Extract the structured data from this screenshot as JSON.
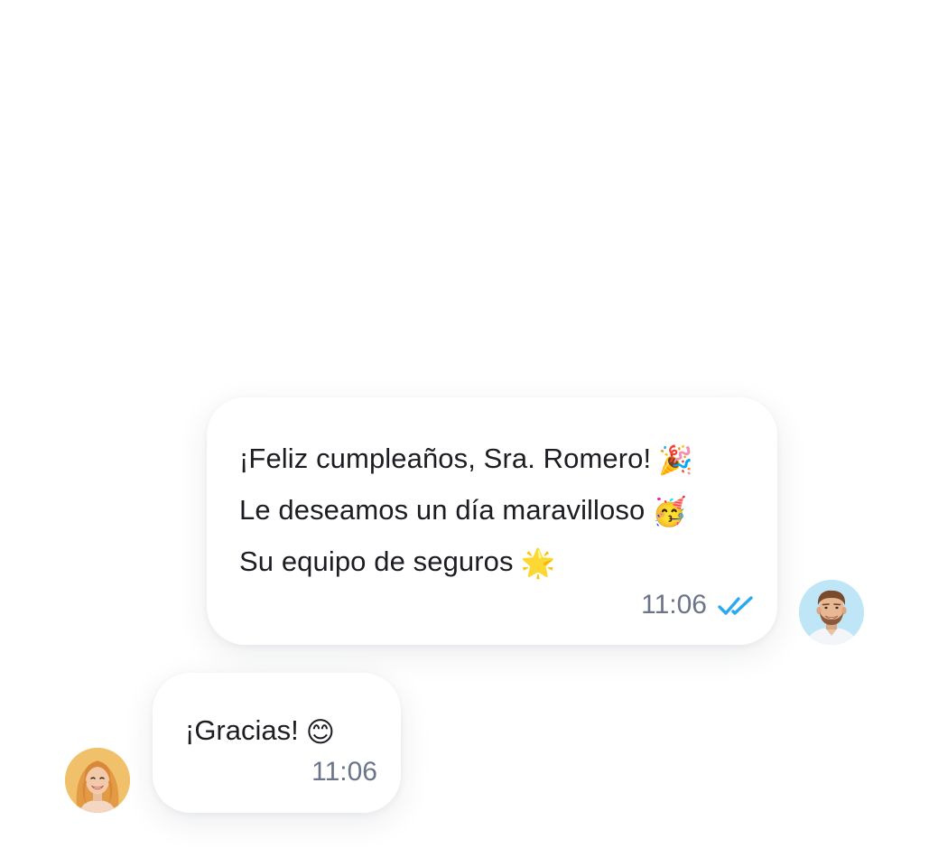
{
  "conversation": {
    "outgoing_message": {
      "lines": [
        {
          "text": "¡Feliz cumpleaños, Sra. Romero!",
          "emoji": "🎉"
        },
        {
          "text": "Le deseamos un día maravilloso",
          "emoji": "🥳"
        },
        {
          "text": "Su equipo de seguros",
          "emoji": "🌟"
        }
      ],
      "time": "11:06",
      "status_icon": "double-check-read-icon",
      "status_color": "#2AA8F2"
    },
    "incoming_message": {
      "text": "¡Gracias!",
      "emoji": "😊",
      "time": "11:06"
    },
    "agent_avatar": {
      "icon": "man-avatar",
      "background": "#BFE6F7"
    },
    "customer_avatar": {
      "icon": "woman-avatar",
      "background": "#F1C06A"
    }
  }
}
